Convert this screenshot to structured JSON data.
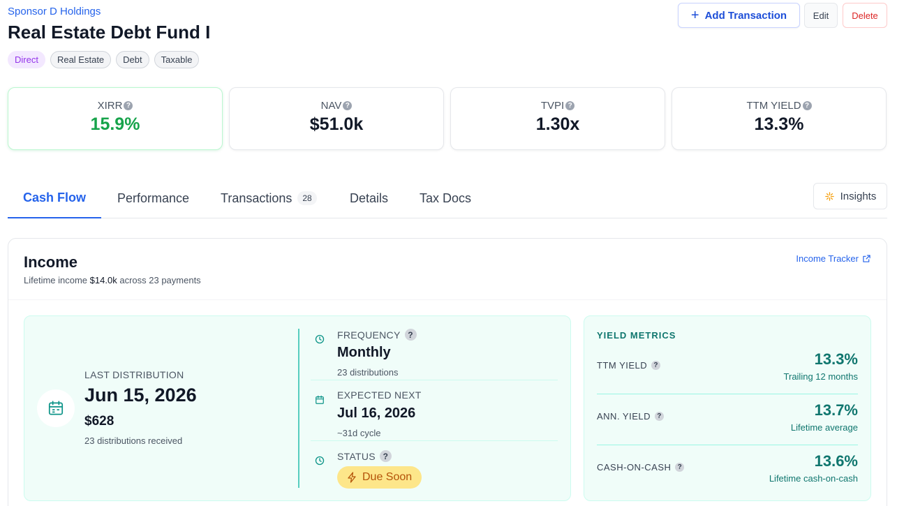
{
  "header": {
    "sponsor": "Sponsor D Holdings",
    "title": "Real Estate Debt Fund I",
    "tags": [
      "Direct",
      "Real Estate",
      "Debt",
      "Taxable"
    ]
  },
  "actions": {
    "add_transaction": "Add Transaction",
    "edit": "Edit",
    "delete": "Delete"
  },
  "metrics": [
    {
      "label": "XIRR",
      "value": "15.9%"
    },
    {
      "label": "NAV",
      "value": "$51.0k"
    },
    {
      "label": "TVPI",
      "value": "1.30x"
    },
    {
      "label": "TTM YIELD",
      "value": "13.3%"
    }
  ],
  "tabs": [
    {
      "label": "Cash Flow"
    },
    {
      "label": "Performance"
    },
    {
      "label": "Transactions",
      "count": "28"
    },
    {
      "label": "Details"
    },
    {
      "label": "Tax Docs"
    }
  ],
  "insights_label": "Insights",
  "income": {
    "title": "Income",
    "subtitle_prefix": "Lifetime income",
    "lifetime_amount": "$14.0k",
    "subtitle_suffix": "across 23 payments",
    "tracker_link": "Income Tracker",
    "last_distribution": {
      "label": "LAST DISTRIBUTION",
      "date": "Jun 15, 2026",
      "amount": "$628",
      "count_text": "23 distributions received"
    },
    "frequency": {
      "label": "FREQUENCY",
      "value": "Monthly",
      "sub": "23 distributions"
    },
    "expected_next": {
      "label": "EXPECTED NEXT",
      "value": "Jul 16, 2026",
      "sub": "~31d cycle"
    },
    "status": {
      "label": "STATUS",
      "value": "Due Soon"
    }
  },
  "yield_metrics": {
    "title": "YIELD METRICS",
    "rows": [
      {
        "label": "TTM YIELD",
        "value": "13.3%",
        "sub": "Trailing 12 months"
      },
      {
        "label": "ANN. YIELD",
        "value": "13.7%",
        "sub": "Lifetime average"
      },
      {
        "label": "CASH-ON-CASH",
        "value": "13.6%",
        "sub": "Lifetime cash-on-cash"
      }
    ]
  },
  "colors": {
    "accent": "#2563eb",
    "positive": "#16a34a",
    "teal": "#0f766e",
    "danger": "#dc2626",
    "warning_bg": "#fde68a"
  }
}
